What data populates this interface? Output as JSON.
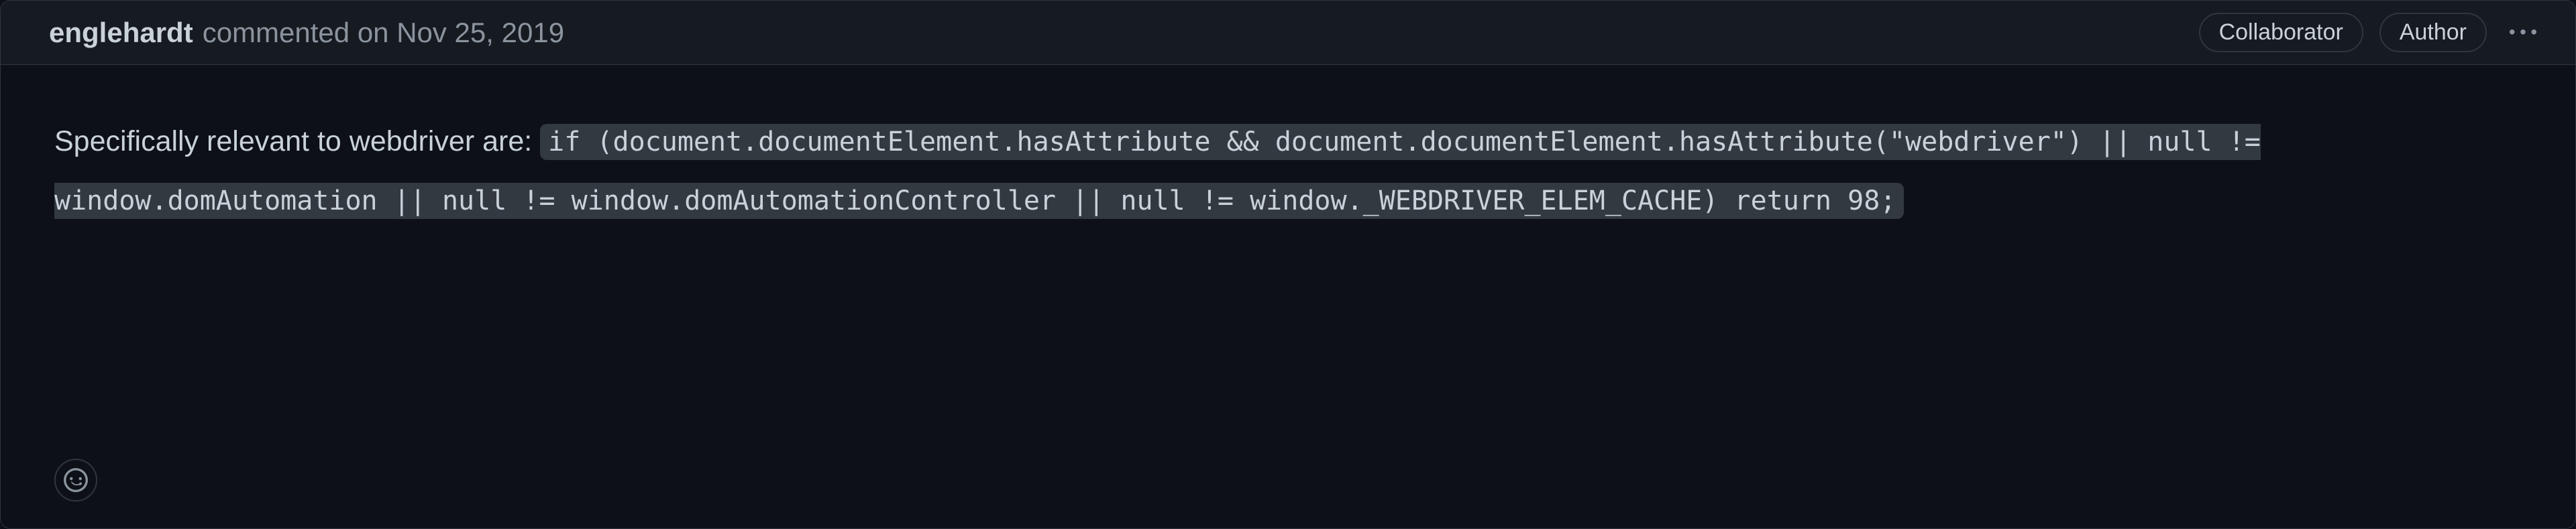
{
  "comment": {
    "author": "englehardt",
    "action_text": "commented",
    "date_prefix": "on",
    "date": "Nov 25, 2019",
    "badges": {
      "collaborator": "Collaborator",
      "author": "Author"
    },
    "body": {
      "lead_text": "Specifically relevant to webdriver are: ",
      "code": "if (document.documentElement.hasAttribute && document.documentElement.hasAttribute(\"webdriver\") || null != window.domAutomation || null != window.domAutomationController || null != window._WEBDRIVER_ELEM_CACHE) return 98;"
    }
  },
  "icons": {
    "kebab": "kebab-horizontal-icon",
    "smiley": "smiley-icon"
  }
}
